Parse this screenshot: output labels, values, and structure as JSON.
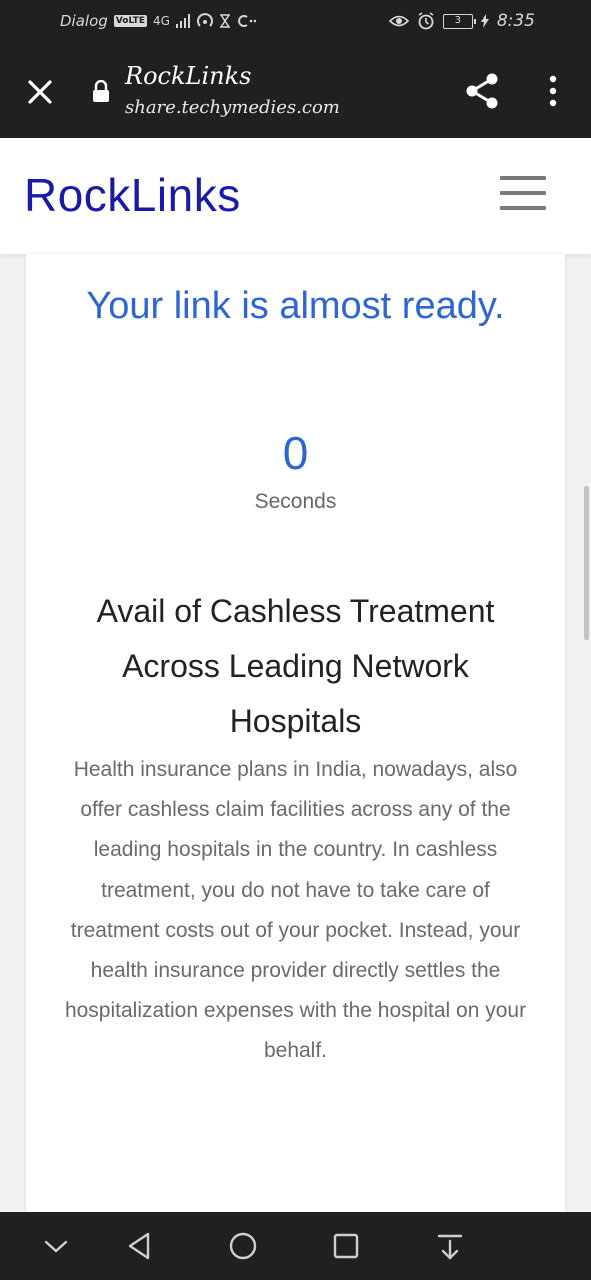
{
  "status_bar": {
    "carrier": "Dialog",
    "volte": "VoLTE",
    "network": "4G",
    "battery_level": "3",
    "time": "8:35"
  },
  "app_bar": {
    "title": "RockLinks",
    "url": "share.techymedies.com",
    "icons": [
      "close-icon",
      "lock-icon",
      "share-icon",
      "more-vert-icon"
    ]
  },
  "site": {
    "brand": "RockLinks",
    "brand_color": "#1a1aa8"
  },
  "content": {
    "headline": "Your link is almost ready.",
    "countdown_value": "0",
    "countdown_label": "Seconds",
    "accent_color": "#2d66d4",
    "article_title": "Avail of Cashless Treatment Across Leading Network Hospitals",
    "article_body": "Health insurance plans in India, nowadays, also offer cashless claim facilities across any of the leading hospitals in the country. In cashless treatment, you do not have to take care of treatment costs out of your pocket. Instead, your health insurance provider directly settles the hospitalization expenses with the hospital on your behalf."
  },
  "nav_bar": {
    "icons": [
      "collapse-icon",
      "back-icon",
      "home-icon",
      "recents-icon",
      "notification-pull-icon"
    ]
  }
}
